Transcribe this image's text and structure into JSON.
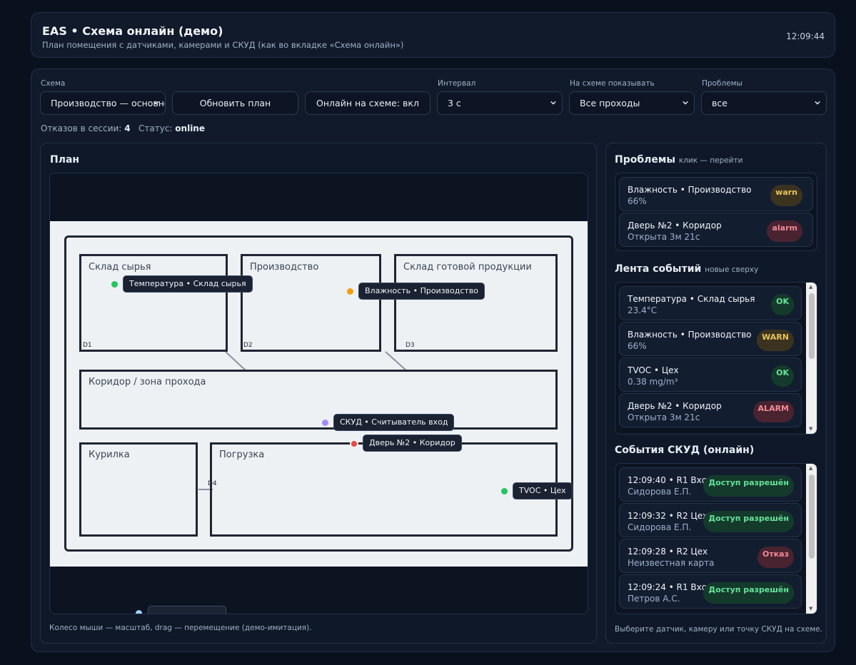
{
  "header": {
    "title": "EAS • Схема онлайн (демо)",
    "subtitle": "План помещения с датчиками, камерами и СКУД (как во вкладке «Схема онлайн»)",
    "clock": "12:09:44"
  },
  "controls": {
    "scheme": {
      "label": "Схема",
      "value": "Производство — основной"
    },
    "refresh_button": "Обновить план",
    "online_toggle": "Онлайн на схеме: вкл",
    "interval": {
      "label": "Интервал",
      "value": "3 с"
    },
    "show_on_scheme": {
      "label": "На схеме показывать",
      "value": "Все проходы"
    },
    "problems_filter": {
      "label": "Проблемы",
      "value": "все"
    }
  },
  "session": {
    "failures_label": "Отказов в сессии:",
    "failures_count": "4",
    "status_label": "Статус:",
    "status_value": "online"
  },
  "plan": {
    "title": "План",
    "rooms": [
      {
        "id": "raw",
        "label": "Склад сырья",
        "door": "D1"
      },
      {
        "id": "prod",
        "label": "Производство",
        "door": "D2"
      },
      {
        "id": "finished",
        "label": "Склад готовой продукции",
        "door": "D3"
      },
      {
        "id": "corridor",
        "label": "Коридор / зона прохода"
      },
      {
        "id": "smoking",
        "label": "Курилка"
      },
      {
        "id": "loading",
        "label": "Погрузка",
        "door": "D4"
      }
    ],
    "markers": [
      {
        "id": "temp",
        "label": "Температура • Склад сырья",
        "color": "#22c55e"
      },
      {
        "id": "hum",
        "label": "Влажность • Производство",
        "color": "#f59e0b"
      },
      {
        "id": "skud",
        "label": "СКУД • Считыватель вход",
        "color": "#a78bfa"
      },
      {
        "id": "door2",
        "label": "Дверь №2 • Коридор",
        "color": "#ef4444"
      },
      {
        "id": "tvoc",
        "label": "TVOC • Цех",
        "color": "#22c55e"
      }
    ],
    "hint": "Колесо мыши — масштаб, drag — перемещение (демо-имитация)."
  },
  "problems": {
    "title": "Проблемы",
    "subtitle": "клик — перейти",
    "items": [
      {
        "title": "Влажность • Производство",
        "value": "66%",
        "badge": "warn",
        "level": "warn"
      },
      {
        "title": "Дверь №2 • Коридор",
        "value": "Открыта 3м 21с",
        "badge": "alarm",
        "level": "alarm"
      }
    ]
  },
  "feed": {
    "title": "Лента событий",
    "subtitle": "новые сверху",
    "items": [
      {
        "title": "Температура • Склад сырья",
        "value": "23.4°C",
        "badge": "OK",
        "level": "ok"
      },
      {
        "title": "Влажность • Производство",
        "value": "66%",
        "badge": "WARN",
        "level": "warn"
      },
      {
        "title": "TVOC • Цех",
        "value": "0.38 mg/m³",
        "badge": "OK",
        "level": "ok"
      },
      {
        "title": "Дверь №2 • Коридор",
        "value": "Открыта 3м 21с",
        "badge": "ALARM",
        "level": "alarm"
      }
    ]
  },
  "skud": {
    "title": "События СКУД (онлайн)",
    "items": [
      {
        "title": "12:09:40 • R1 Вход",
        "person": "Сидорова Е.П.",
        "badge": "Доступ разрешён",
        "level": "ok"
      },
      {
        "title": "12:09:32 • R2 Цех",
        "person": "Сидорова Е.П.",
        "badge": "Доступ разрешён",
        "level": "ok"
      },
      {
        "title": "12:09:28 • R2 Цех",
        "person": "Неизвестная карта",
        "badge": "Отказ",
        "level": "alarm"
      },
      {
        "title": "12:09:24 • R1 Вход",
        "person": "Петров А.С.",
        "badge": "Доступ разрешён",
        "level": "ok"
      }
    ]
  },
  "side_hint": "Выберите датчик, камеру или точку СКУД на схеме."
}
